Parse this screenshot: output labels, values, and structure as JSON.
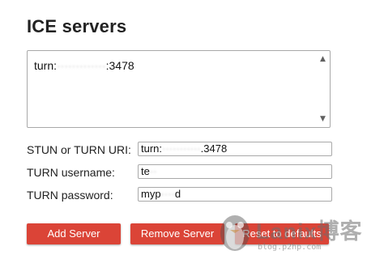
{
  "heading": "ICE servers",
  "servers_list": {
    "prefix": "turn:",
    "masked": "·············",
    "suffix": ":3478"
  },
  "fields": {
    "uri": {
      "label": "STUN or TURN URI:",
      "value_prefix": "turn:",
      "value_masked": "···········",
      "value_suffix": ".3478"
    },
    "username": {
      "label": "TURN username:",
      "value_prefix": "te",
      "value_masked": "··"
    },
    "password": {
      "label": "TURN password:",
      "value_prefix": "myp",
      "value_masked": "····",
      "value_suffix": "d"
    }
  },
  "buttons": {
    "add": "Add Server",
    "remove": "Remove Server",
    "reset": "Reset to defaults"
  },
  "colors": {
    "button_bg": "#db4437",
    "button_text": "#ffffff"
  },
  "watermark": {
    "brand": "Lanix博客",
    "url": "blog.p2hp.com"
  },
  "icons": {
    "scroll_up": "scroll-up-arrow-icon",
    "scroll_down": "scroll-down-arrow-icon",
    "watermark_logo": "penguin-logo-icon"
  }
}
